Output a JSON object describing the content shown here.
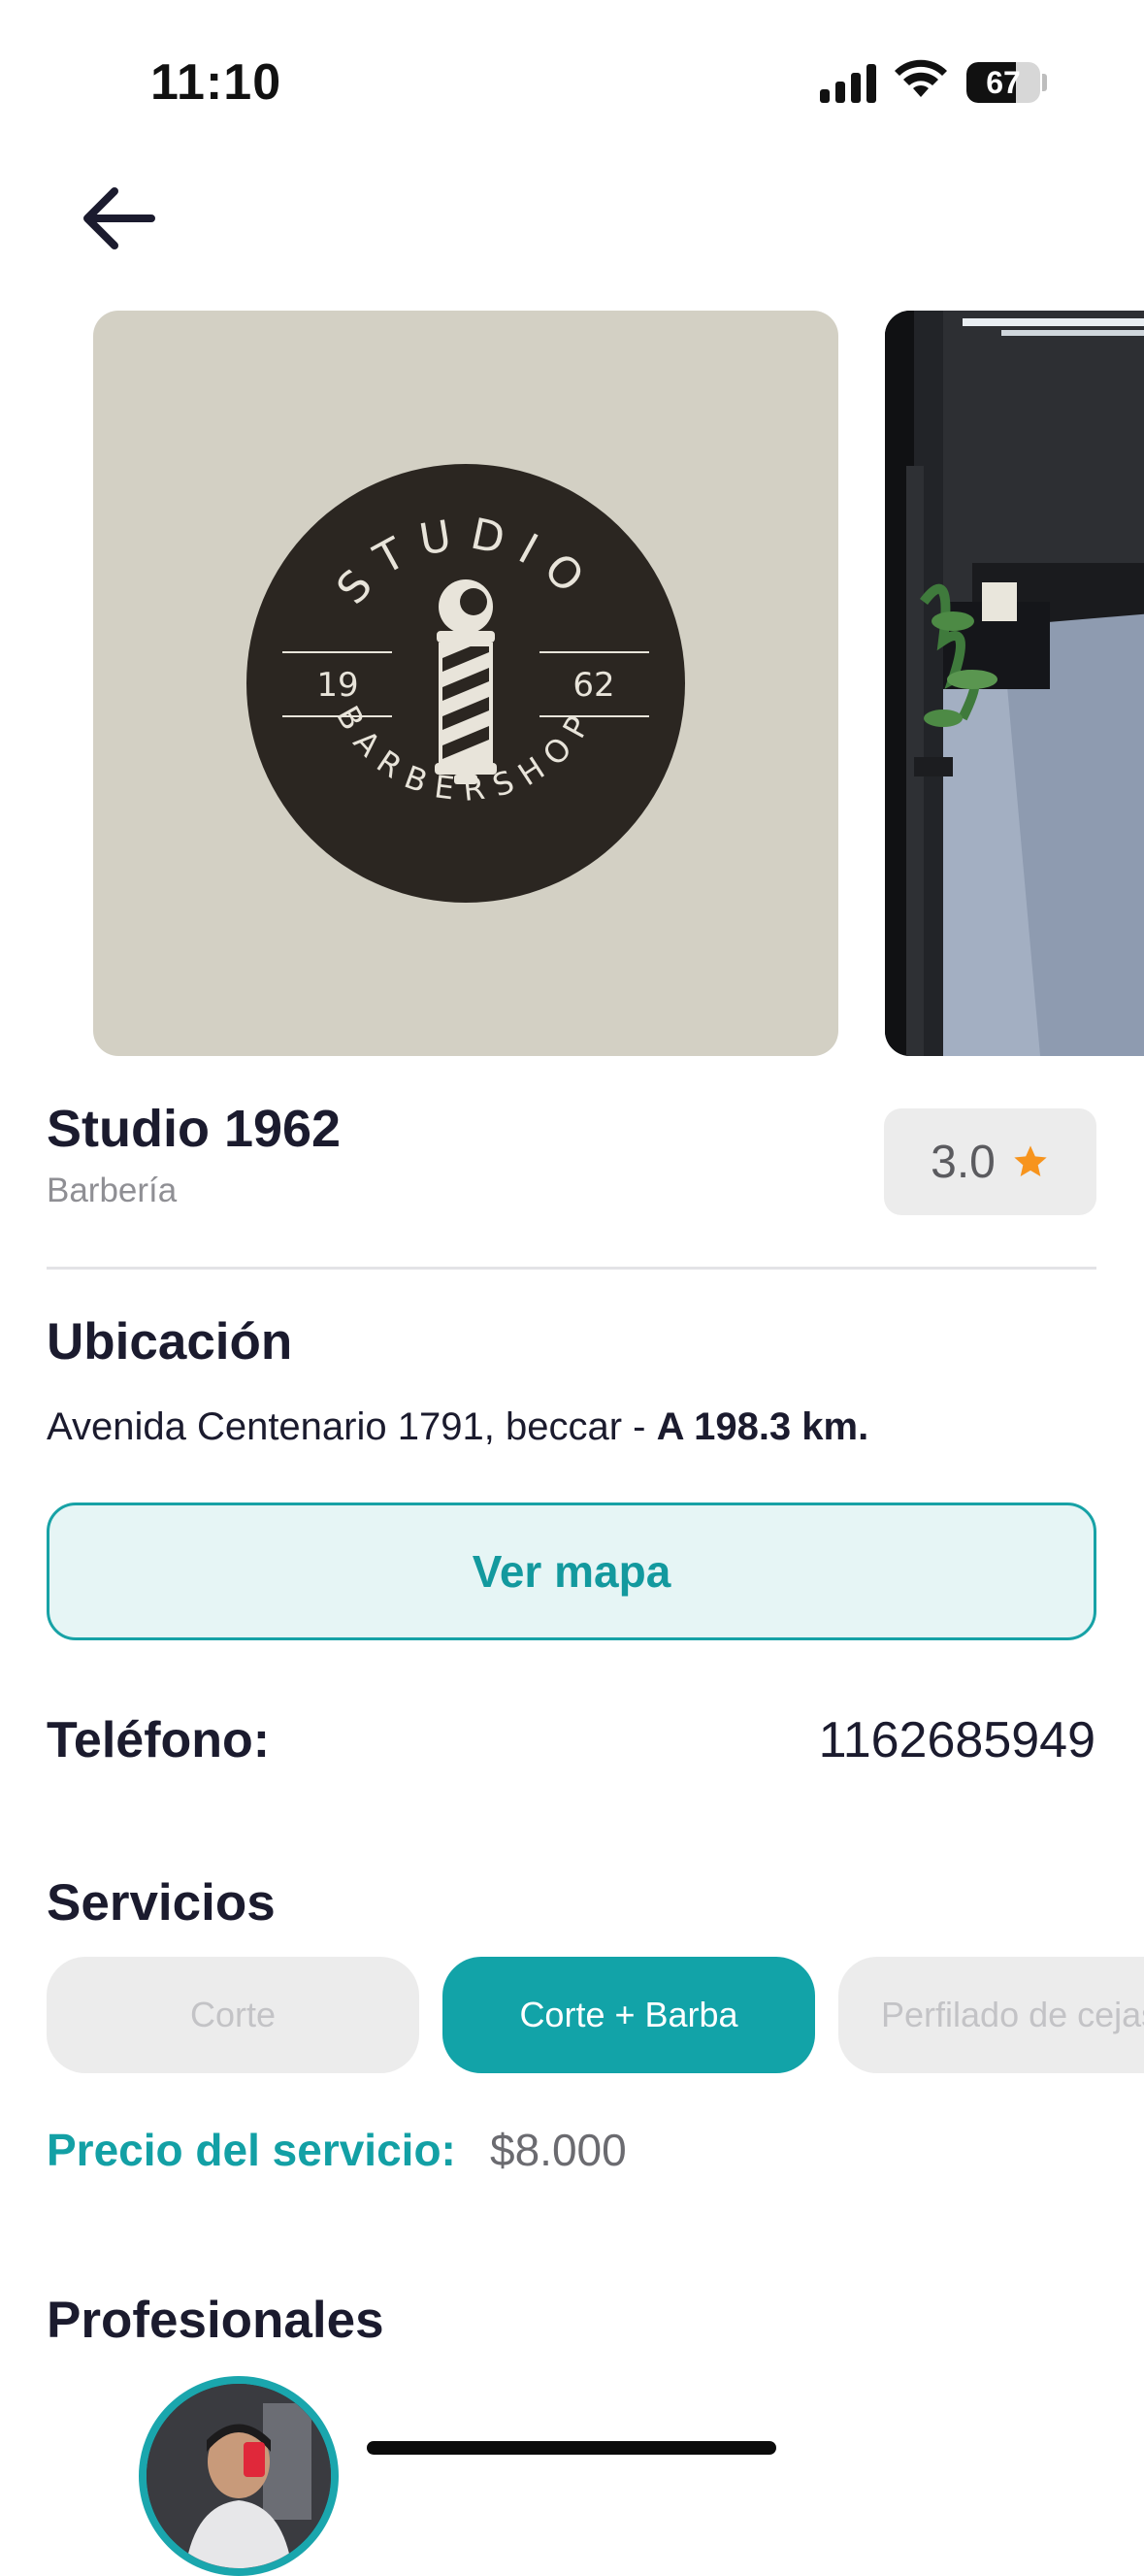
{
  "status_bar": {
    "time": "11:10",
    "battery": "67",
    "battery_level": 0.67
  },
  "icons": {
    "back": "arrow-left-icon",
    "rating_star": "star-icon",
    "signal": "cellular-signal-icon",
    "wifi": "wifi-icon",
    "battery": "battery-icon"
  },
  "gallery": {
    "logo": {
      "top_text": "STUDIO",
      "left_year": "19",
      "right_year": "62",
      "bottom_text": "BARBERSHOP"
    }
  },
  "business": {
    "name": "Studio 1962",
    "category": "Barbería",
    "rating": "3.0"
  },
  "location": {
    "title": "Ubicación",
    "address": "Avenida Centenario 1791, beccar - ",
    "distance": "A 198.3 km.",
    "map_button": "Ver mapa"
  },
  "phone": {
    "label": "Teléfono:",
    "value": "1162685949"
  },
  "services": {
    "title": "Servicios",
    "items": [
      "Corte",
      "Corte + Barba",
      "Perfilado de cejas"
    ],
    "selected": "Corte + Barba"
  },
  "price": {
    "label": "Precio del servicio:",
    "value": "$8.000"
  },
  "professionals": {
    "title": "Profesionales"
  },
  "colors": {
    "accent": "#12a3a8",
    "text": "#1b1b2e",
    "muted": "#8f8f94",
    "star": "#f7941d",
    "chip_bg": "#ececec"
  }
}
